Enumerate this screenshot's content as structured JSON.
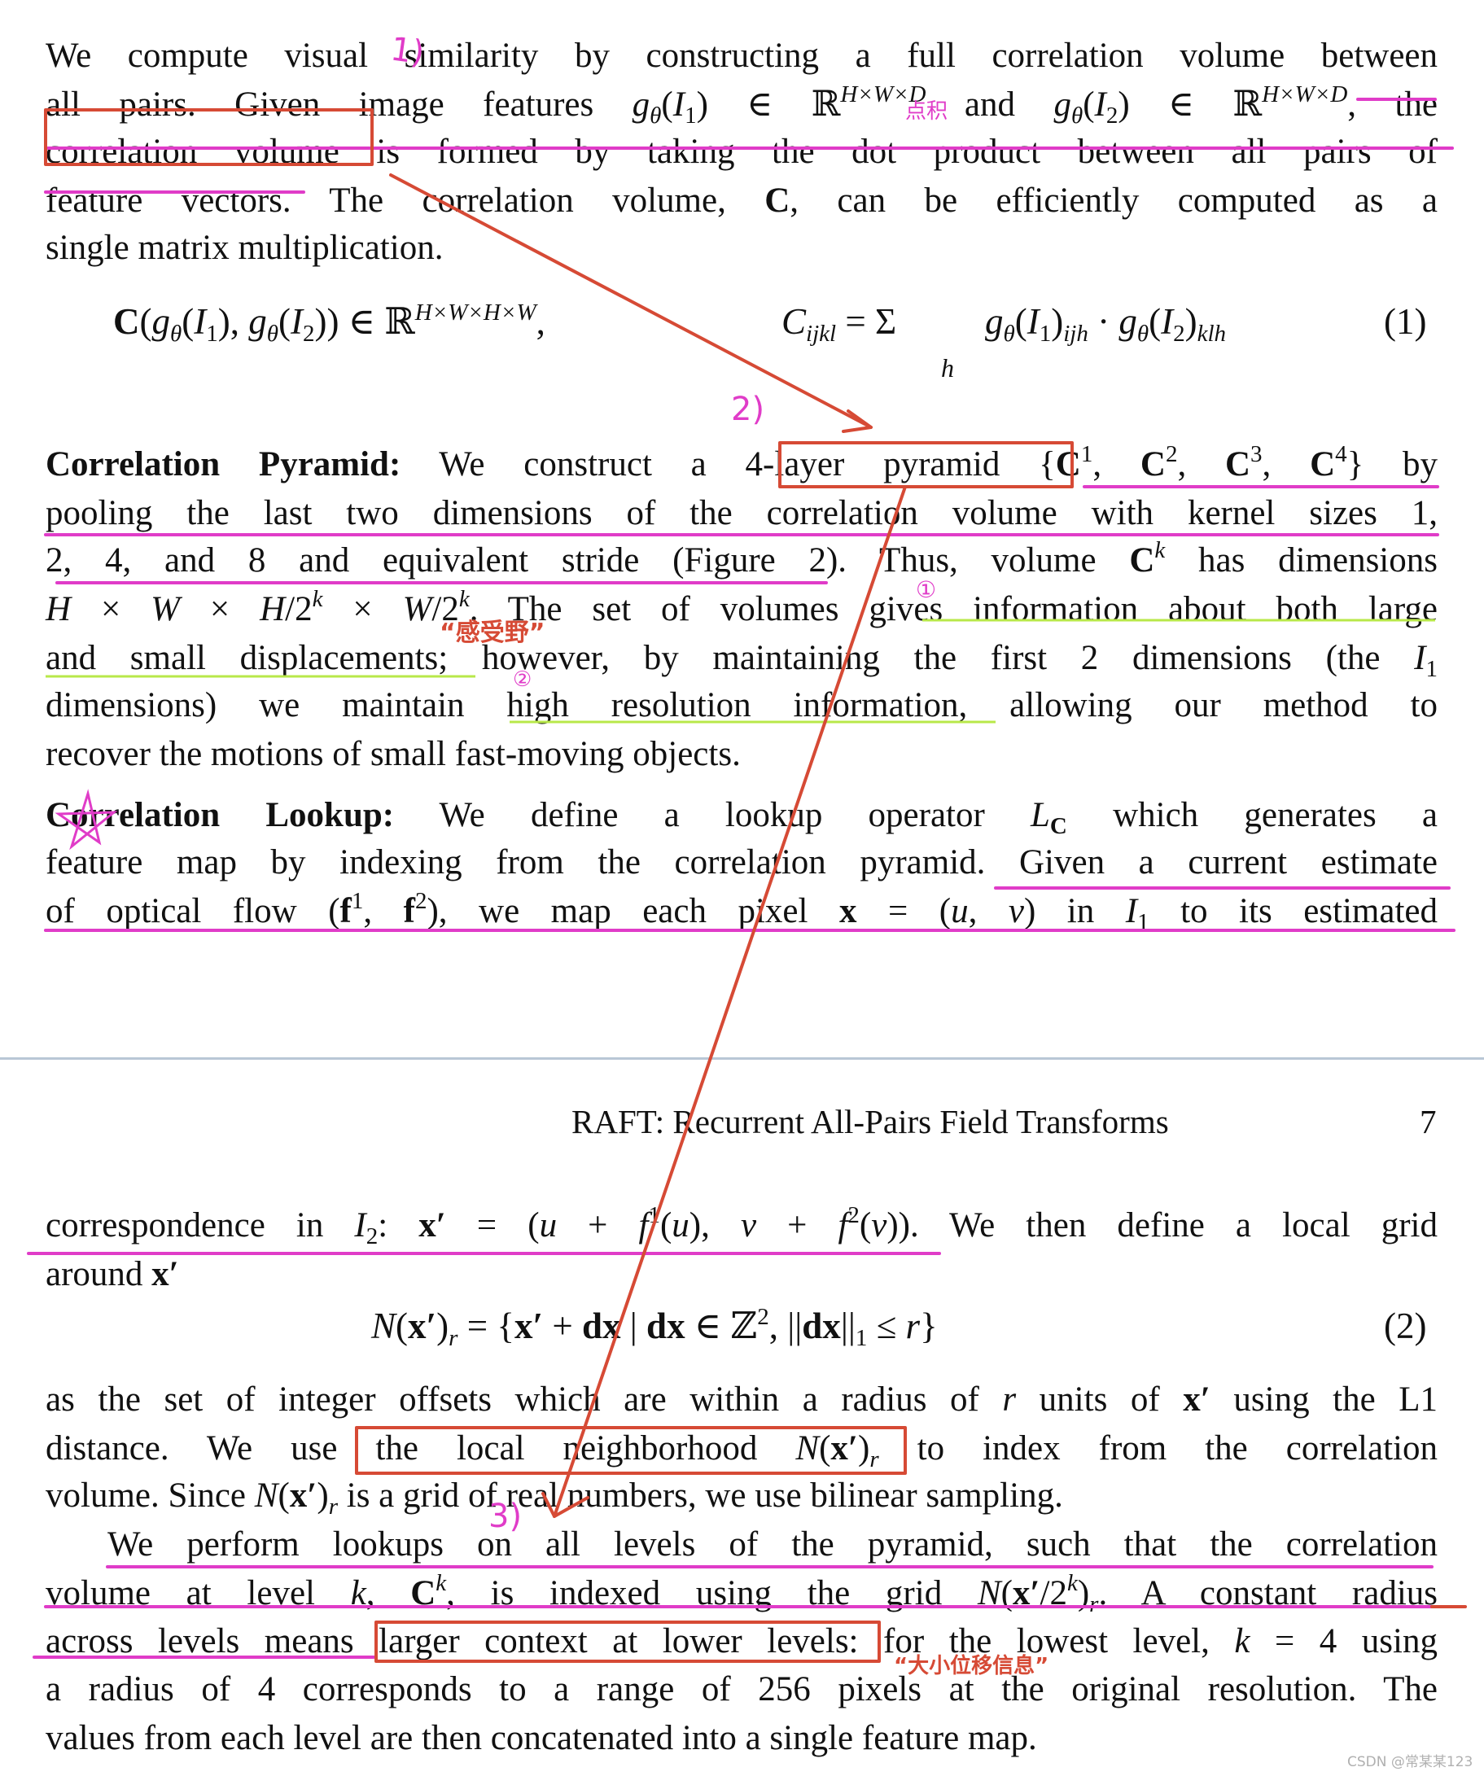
{
  "header": {
    "running_title": "RAFT: Recurrent All-Pairs Field Transforms",
    "page_number": "7"
  },
  "p1": {
    "lines": [
      {
        "segs": [
          [
            "We compute visual similarity by constructing a full correlation volume between",
            ""
          ]
        ]
      },
      {
        "segs": [
          [
            "all pairs. Given image features ",
            ""
          ],
          [
            "g",
            "i"
          ],
          [
            "θ",
            "i_"
          ],
          [
            "(",
            ""
          ],
          [
            "I",
            "i"
          ],
          [
            "1",
            "_"
          ],
          [
            ") ∈ ℝ",
            ""
          ],
          [
            "H×W×D",
            "i^"
          ],
          [
            " and ",
            ""
          ],
          [
            "g",
            "i"
          ],
          [
            "θ",
            "i_"
          ],
          [
            "(",
            ""
          ],
          [
            "I",
            "i"
          ],
          [
            "2",
            "_"
          ],
          [
            ") ∈ ℝ",
            ""
          ],
          [
            "H×W×D",
            "i^"
          ],
          [
            ", the",
            ""
          ]
        ]
      },
      {
        "segs": [
          [
            "correlation volume is formed by taking the dot product between all pairs of",
            ""
          ]
        ]
      },
      {
        "segs": [
          [
            "feature vectors. The correlation volume, ",
            ""
          ],
          [
            "C",
            "b"
          ],
          [
            ", can be efficiently computed as a",
            ""
          ]
        ]
      },
      {
        "segs": [
          [
            "single matrix multiplication.",
            ""
          ]
        ]
      }
    ]
  },
  "eq1": {
    "left": [
      [
        "C",
        "b"
      ],
      [
        "(",
        ""
      ],
      [
        "g",
        "i"
      ],
      [
        "θ",
        "i_"
      ],
      [
        "(",
        ""
      ],
      [
        "I",
        "i"
      ],
      [
        "1",
        "_"
      ],
      [
        "), ",
        ""
      ],
      [
        "g",
        "i"
      ],
      [
        "θ",
        "i_"
      ],
      [
        "(",
        ""
      ],
      [
        "I",
        "i"
      ],
      [
        "2",
        "_"
      ],
      [
        ")) ∈ ℝ",
        ""
      ],
      [
        "H×W×H×W",
        "i^"
      ],
      [
        ",",
        ""
      ]
    ],
    "right": [
      [
        "C",
        "i"
      ],
      [
        "ijkl",
        "i_"
      ],
      [
        " = ",
        ""
      ],
      [
        "Σ",
        ""
      ]
    ],
    "sum_index": "h",
    "rhs": [
      [
        "g",
        "i"
      ],
      [
        "θ",
        "i_"
      ],
      [
        "(",
        ""
      ],
      [
        "I",
        "i"
      ],
      [
        "1",
        "_"
      ],
      [
        ")",
        ""
      ],
      [
        "ijh",
        "i_"
      ],
      [
        " · ",
        ""
      ],
      [
        "g",
        "i"
      ],
      [
        "θ",
        "i_"
      ],
      [
        "(",
        ""
      ],
      [
        "I",
        "i"
      ],
      [
        "2",
        "_"
      ],
      [
        ")",
        ""
      ],
      [
        "klh",
        "i_"
      ]
    ],
    "number": "(1)"
  },
  "p2": {
    "lines": [
      {
        "segs": [
          [
            "Correlation Pyramid:",
            "b"
          ],
          [
            " We construct a 4-layer pyramid {",
            ""
          ],
          [
            "C",
            "b"
          ],
          [
            "1",
            "^"
          ],
          [
            ", ",
            ""
          ],
          [
            "C",
            "b"
          ],
          [
            "2",
            "^"
          ],
          [
            ", ",
            ""
          ],
          [
            "C",
            "b"
          ],
          [
            "3",
            "^"
          ],
          [
            ", ",
            ""
          ],
          [
            "C",
            "b"
          ],
          [
            "4",
            "^"
          ],
          [
            "} by",
            ""
          ]
        ]
      },
      {
        "segs": [
          [
            "pooling the last two dimensions of the correlation volume with kernel sizes 1,",
            ""
          ]
        ]
      },
      {
        "segs": [
          [
            "2, 4, and 8 and equivalent stride (Figure 2). Thus, volume ",
            ""
          ],
          [
            "C",
            "b"
          ],
          [
            "k",
            "i^"
          ],
          [
            " has dimensions",
            ""
          ]
        ]
      },
      {
        "segs": [
          [
            "H",
            "i"
          ],
          [
            " × ",
            ""
          ],
          [
            "W",
            "i"
          ],
          [
            " × ",
            ""
          ],
          [
            "H",
            "i"
          ],
          [
            "/2",
            ""
          ],
          [
            "k",
            "i^"
          ],
          [
            " × ",
            ""
          ],
          [
            "W",
            "i"
          ],
          [
            "/2",
            ""
          ],
          [
            "k",
            "i^"
          ],
          [
            ". The set of volumes gives information about both large",
            ""
          ]
        ]
      },
      {
        "segs": [
          [
            "and small displacements; however, by maintaining the first 2 dimensions (the ",
            ""
          ],
          [
            "I",
            "i"
          ],
          [
            "1",
            "_"
          ]
        ]
      },
      {
        "segs": [
          [
            "dimensions) we maintain high resolution information, allowing our method to",
            ""
          ]
        ]
      },
      {
        "segs": [
          [
            "recover the motions of small fast-moving objects.",
            ""
          ]
        ]
      }
    ]
  },
  "p3": {
    "lines": [
      {
        "segs": [
          [
            "Correlation Lookup:",
            "b"
          ],
          [
            "  We define a lookup operator ",
            ""
          ],
          [
            "L",
            "i"
          ],
          [
            "C",
            "b_"
          ],
          [
            " which generates a",
            ""
          ]
        ]
      },
      {
        "segs": [
          [
            "feature map by indexing from the correlation pyramid. Given a current estimate",
            ""
          ]
        ]
      },
      {
        "segs": [
          [
            "of optical flow (",
            ""
          ],
          [
            "f",
            "b"
          ],
          [
            "1",
            "^"
          ],
          [
            ", ",
            ""
          ],
          [
            "f",
            "b"
          ],
          [
            "2",
            "^"
          ],
          [
            "), we map each pixel ",
            ""
          ],
          [
            "x",
            "b"
          ],
          [
            " = (",
            ""
          ],
          [
            "u",
            "i"
          ],
          [
            ", ",
            ""
          ],
          [
            "v",
            "i"
          ],
          [
            ") in ",
            ""
          ],
          [
            "I",
            "i"
          ],
          [
            "1",
            "_"
          ],
          [
            " to its estimated",
            ""
          ]
        ]
      }
    ]
  },
  "p4": {
    "lines": [
      {
        "segs": [
          [
            "correspondence in ",
            ""
          ],
          [
            "I",
            "i"
          ],
          [
            "2",
            "_"
          ],
          [
            ": ",
            ""
          ],
          [
            "x′",
            "b"
          ],
          [
            " = (",
            ""
          ],
          [
            "u",
            "i"
          ],
          [
            " + ",
            ""
          ],
          [
            "f",
            "i"
          ],
          [
            "1",
            "^"
          ],
          [
            "(",
            ""
          ],
          [
            "u",
            "i"
          ],
          [
            "), ",
            ""
          ],
          [
            "v",
            "i"
          ],
          [
            " + ",
            ""
          ],
          [
            "f",
            "i"
          ],
          [
            "2",
            "^"
          ],
          [
            "(",
            ""
          ],
          [
            "v",
            "i"
          ],
          [
            ")). We then define a local grid",
            ""
          ]
        ]
      },
      {
        "segs": [
          [
            "around ",
            ""
          ],
          [
            "x′",
            "b"
          ]
        ]
      }
    ]
  },
  "eq2": {
    "expr": [
      [
        "N",
        "i"
      ],
      [
        "(",
        ""
      ],
      [
        "x′",
        "b"
      ],
      [
        ")",
        ""
      ],
      [
        "r",
        "i_"
      ],
      [
        " = {",
        ""
      ],
      [
        "x′",
        "b"
      ],
      [
        " + ",
        ""
      ],
      [
        "dx",
        "b"
      ],
      [
        " | ",
        ""
      ],
      [
        "dx",
        "b"
      ],
      [
        " ∈ ℤ",
        ""
      ],
      [
        "2",
        "^"
      ],
      [
        ", ||",
        ""
      ],
      [
        "dx",
        "b"
      ],
      [
        "||",
        ""
      ],
      [
        "1",
        "_"
      ],
      [
        " ≤ ",
        ""
      ],
      [
        "r",
        "i"
      ],
      [
        "}",
        ""
      ]
    ],
    "number": "(2)"
  },
  "p5": {
    "lines": [
      {
        "segs": [
          [
            "as the set of integer offsets which are within a radius of ",
            ""
          ],
          [
            "r",
            "i"
          ],
          [
            " units of ",
            ""
          ],
          [
            "x′",
            "b"
          ],
          [
            " using the L1",
            ""
          ]
        ]
      },
      {
        "segs": [
          [
            "distance. We use the local neighborhood ",
            ""
          ],
          [
            "N",
            "i"
          ],
          [
            "(",
            ""
          ],
          [
            "x′",
            "b"
          ],
          [
            ")",
            ""
          ],
          [
            "r",
            "i_"
          ],
          [
            " to index from the correlation",
            ""
          ]
        ]
      },
      {
        "segs": [
          [
            "volume. Since ",
            ""
          ],
          [
            "N",
            "i"
          ],
          [
            "(",
            ""
          ],
          [
            "x′",
            "b"
          ],
          [
            ")",
            ""
          ],
          [
            "r",
            "i_"
          ],
          [
            " is a grid of real numbers, we use bilinear sampling.",
            ""
          ]
        ]
      }
    ]
  },
  "p6": {
    "lines": [
      {
        "segs": [
          [
            "We perform lookups on all levels of the pyramid, such that the correlation",
            ""
          ]
        ]
      },
      {
        "segs": [
          [
            "volume at level ",
            ""
          ],
          [
            "k",
            "i"
          ],
          [
            ", ",
            ""
          ],
          [
            "C",
            "b"
          ],
          [
            "k",
            "i^"
          ],
          [
            ", is indexed using the grid ",
            ""
          ],
          [
            "N",
            "i"
          ],
          [
            "(",
            ""
          ],
          [
            "x′",
            "b"
          ],
          [
            "/2",
            ""
          ],
          [
            "k",
            "i^"
          ],
          [
            ")",
            ""
          ],
          [
            "r",
            "i_"
          ],
          [
            ". A constant radius",
            ""
          ]
        ]
      },
      {
        "segs": [
          [
            "across levels means larger context at lower levels: for the lowest level, ",
            ""
          ],
          [
            "k",
            "i"
          ],
          [
            " = 4 using",
            ""
          ]
        ]
      },
      {
        "segs": [
          [
            "a radius of 4 corresponds to a range of 256 pixels at the original resolution. The",
            ""
          ]
        ]
      },
      {
        "segs": [
          [
            "values from each level are then concatenated into a single feature map.",
            ""
          ]
        ]
      }
    ]
  },
  "annotations": {
    "note_1": "1)",
    "note_dot": "点积",
    "note_2": "2)",
    "note_circle_1": "①",
    "note_receptive_field": "“感受野”",
    "note_circle_2": "②",
    "note_3": "3)",
    "note_displacement": "“大小位移信息”",
    "highlight_color": "#e03cc8",
    "secondary_highlight_color": "#b8e84a",
    "box_color": "#d64a35"
  },
  "watermark": "CSDN @常某某123"
}
